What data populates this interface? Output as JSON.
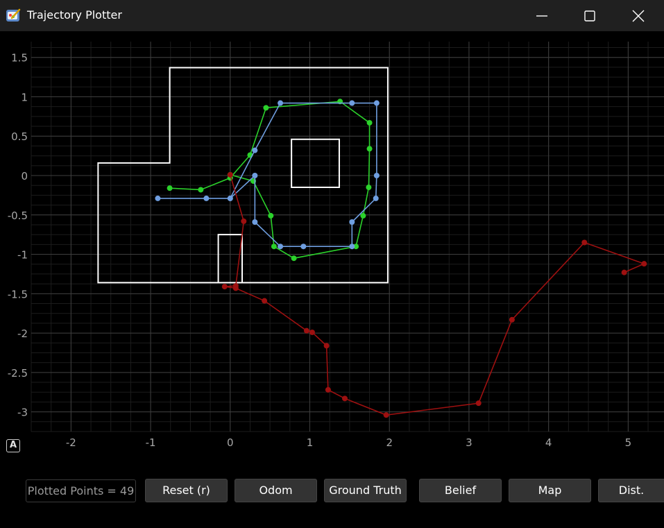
{
  "window": {
    "title": "Trajectory Plotter",
    "icon": "paint-palette-icon"
  },
  "controls": {
    "autoscale_label": "A",
    "plotted_points_label": "Plotted Points = 49",
    "buttons": [
      "Reset (r)",
      "Odom",
      "Ground Truth",
      "Belief",
      "Map",
      "Dist."
    ]
  },
  "chart_data": {
    "type": "line",
    "xlim": [
      -2.5,
      5.45
    ],
    "ylim": [
      -3.25,
      1.7
    ],
    "x_ticks": [
      -2,
      -1,
      0,
      1,
      2,
      3,
      4,
      5
    ],
    "y_ticks": [
      1.5,
      1,
      0.5,
      0,
      -0.5,
      -1,
      -1.5,
      -2,
      -2.5,
      -3
    ],
    "x_tick_labels": [
      "-2",
      "-1",
      "0",
      "1",
      "2",
      "3",
      "4",
      "5"
    ],
    "y_tick_labels": [
      "1.5",
      "1",
      "0.5",
      "0",
      "-0.5",
      "-1",
      "-1.5",
      "-2",
      "-2.5",
      "-3"
    ],
    "grid": true,
    "background": "#000000",
    "map_color": "#ffffff",
    "map": [
      {
        "closed": true,
        "points": [
          [
            -1.66,
            -1.36
          ],
          [
            1.98,
            -1.36
          ],
          [
            1.98,
            1.37
          ],
          [
            -0.76,
            1.37
          ],
          [
            -0.76,
            0.16
          ],
          [
            -1.66,
            0.16
          ]
        ]
      },
      {
        "closed": true,
        "points": [
          [
            0.77,
            -0.15
          ],
          [
            1.37,
            -0.15
          ],
          [
            1.37,
            0.46
          ],
          [
            0.77,
            0.46
          ]
        ]
      },
      {
        "closed": false,
        "points": [
          [
            -0.15,
            -1.36
          ],
          [
            -0.15,
            -0.75
          ],
          [
            0.15,
            -0.75
          ],
          [
            0.15,
            -1.36
          ]
        ]
      }
    ],
    "series": [
      {
        "color": "#2bd12b",
        "points": [
          [
            -0.76,
            -0.16
          ],
          [
            -0.37,
            -0.18
          ],
          [
            0.0,
            -0.03
          ],
          [
            0.0,
            0.01
          ],
          [
            0.29,
            -0.07
          ],
          [
            0.51,
            -0.51
          ],
          [
            0.55,
            -0.9
          ],
          [
            0.8,
            -1.05
          ],
          [
            1.58,
            -0.9
          ],
          [
            1.67,
            -0.51
          ],
          [
            1.74,
            -0.15
          ],
          [
            1.75,
            0.34
          ],
          [
            1.75,
            0.67
          ],
          [
            1.38,
            0.94
          ],
          [
            0.45,
            0.86
          ],
          [
            0.25,
            0.26
          ],
          [
            0.0,
            -0.03
          ]
        ]
      },
      {
        "color": "#6f9ee0",
        "points": [
          [
            -0.91,
            -0.29
          ],
          [
            -0.3,
            -0.29
          ],
          [
            0.0,
            -0.29
          ],
          [
            0.31,
            0.0
          ],
          [
            0.31,
            -0.59
          ],
          [
            0.63,
            -0.9
          ],
          [
            0.92,
            -0.9
          ],
          [
            1.53,
            -0.9
          ],
          [
            1.53,
            -0.59
          ],
          [
            1.83,
            -0.29
          ],
          [
            1.84,
            0.0
          ],
          [
            1.84,
            0.92
          ],
          [
            1.53,
            0.92
          ],
          [
            0.63,
            0.92
          ],
          [
            0.31,
            0.32
          ],
          [
            0.0,
            -0.29
          ]
        ]
      },
      {
        "color": "#9e1010",
        "points": [
          [
            0.0,
            0.01
          ],
          [
            0.17,
            -0.58
          ],
          [
            0.07,
            -1.4
          ],
          [
            -0.07,
            -1.41
          ],
          [
            0.07,
            -1.43
          ],
          [
            0.43,
            -1.59
          ],
          [
            0.96,
            -1.97
          ],
          [
            1.03,
            -1.99
          ],
          [
            1.21,
            -2.16
          ],
          [
            1.23,
            -2.72
          ],
          [
            1.44,
            -2.83
          ],
          [
            1.96,
            -3.04
          ],
          [
            3.12,
            -2.89
          ],
          [
            3.54,
            -1.83
          ],
          [
            4.45,
            -0.85
          ],
          [
            5.2,
            -1.12
          ],
          [
            4.95,
            -1.23
          ]
        ]
      }
    ]
  }
}
